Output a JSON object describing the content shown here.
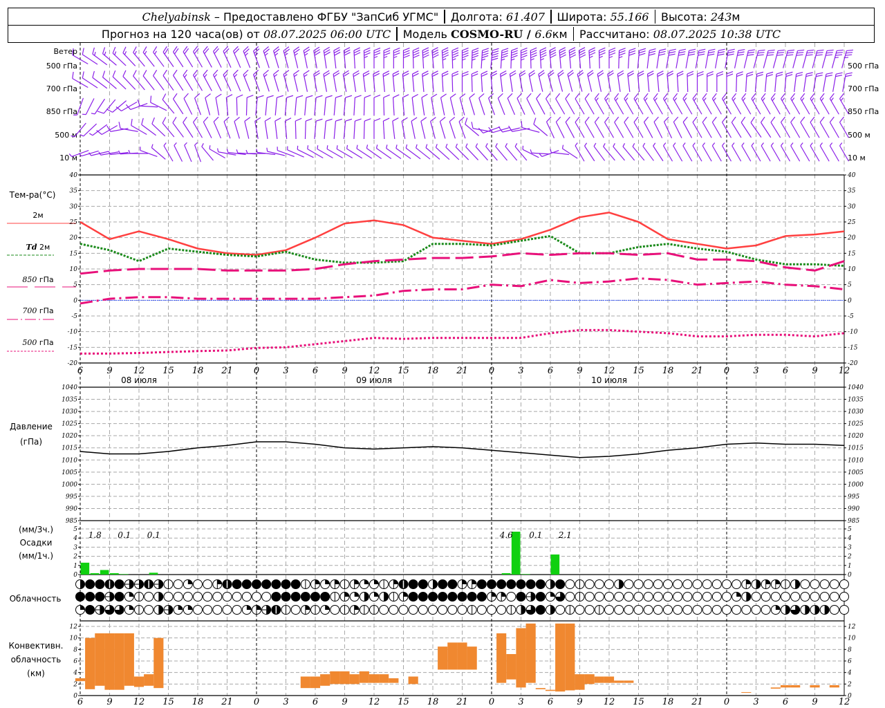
{
  "header": {
    "city": "Chelyabinsk",
    "provider": " – Предоставлено ФГБУ \"ЗапСиб УГМС\"",
    "lon_label": "Долгота: ",
    "lon": "61.407",
    "lat_label": "Широта: ",
    "lat": "55.166",
    "alt_label": "Высота: ",
    "alt": "243",
    "alt_unit": "м",
    "forecast_label": "Прогноз на 120 часа(ов) от ",
    "forecast_time": "08.07.2025 06:00 UTC",
    "model_label": "Модель ",
    "model": "COSMO-RU / ",
    "model_res": "6.6",
    "model_res_unit": "км",
    "calc_label": "Рассчитано: ",
    "calc_time": "08.07.2025 10:38 UTC"
  },
  "labels": {
    "wind": "Ветер",
    "wind_levels": [
      "500 гПа",
      "700 гПа",
      "850 гПа",
      "500 м",
      "10 м"
    ],
    "temp": "Тем-ра(°C)",
    "t2m": "2м",
    "td_a": "Td",
    "td_b": "2м",
    "t850_a": "850",
    "t850_b": "гПа",
    "t700_a": "700",
    "t700_b": "гПа",
    "t500_a": "500",
    "t500_b": "гПа",
    "pressure_a": "Давление",
    "pressure_b": "(гПа)",
    "precip_a": "(мм/3ч.)",
    "precip_b": "Осадки",
    "precip_c": "(мм/1ч.)",
    "cloud": "Облачность",
    "conv_a": "Конвективн.",
    "conv_b": "облачность",
    "conv_c": "(км)"
  },
  "colors": {
    "t2m": "#ff4040",
    "td": "#1a8a1a",
    "upper": "#e8107a",
    "wind": "#8a1ee8",
    "zero": "#3050ff",
    "precip": "#10d010",
    "conv": "#f08830",
    "grid": "#a8a8a8"
  },
  "chart_data": {
    "type": "meteogram",
    "x_hours_from_start": [
      0,
      3,
      6,
      9,
      12,
      15,
      18,
      21,
      24,
      27,
      30,
      33,
      36,
      39,
      42,
      45,
      48,
      51,
      54,
      57,
      60,
      63,
      66,
      69,
      72,
      75,
      78
    ],
    "x_tick_labels": [
      "6",
      "9",
      "12",
      "15",
      "18",
      "21",
      "0",
      "3",
      "6",
      "9",
      "12",
      "15",
      "18",
      "21",
      "0",
      "3",
      "6",
      "9",
      "12",
      "15",
      "18",
      "21",
      "0",
      "3",
      "6",
      "9",
      "12"
    ],
    "day_labels": [
      {
        "label": "08 июля",
        "hour": 6
      },
      {
        "label": "09 июля",
        "hour": 30
      },
      {
        "label": "10 июля",
        "hour": 54
      }
    ],
    "temperature": {
      "ylim": [
        -20,
        40
      ],
      "ticks": [
        "40",
        "35",
        "30",
        "25",
        "20",
        "15",
        "10",
        "5",
        "0",
        "-5",
        "-10",
        "-15",
        "-20"
      ],
      "series": [
        {
          "name": "T 2м",
          "style": "solid",
          "values": [
            25,
            19.5,
            22,
            19.5,
            16.5,
            15,
            14.5,
            16,
            20,
            24.5,
            25.5,
            24,
            20,
            19,
            18,
            19.5,
            22.5,
            26.5,
            28,
            25,
            19.5,
            18,
            16.5,
            17.5,
            20.5,
            21,
            22
          ]
        },
        {
          "name": "Td 2м",
          "style": "dotted-green",
          "values": [
            18,
            16,
            12.5,
            16.5,
            15.5,
            14.5,
            14,
            15.5,
            13,
            12,
            12,
            12.5,
            18,
            18,
            17.5,
            19,
            20.5,
            15,
            15,
            17,
            18,
            16.5,
            15.5,
            13,
            11.5,
            11.5,
            11
          ]
        },
        {
          "name": "T 850 гПа",
          "style": "long-dash",
          "values": [
            8.5,
            9.5,
            10,
            10,
            10,
            9.5,
            9.5,
            9.5,
            10,
            11.5,
            12.5,
            13,
            13.5,
            13.5,
            14,
            15,
            14.5,
            15,
            15,
            14.5,
            15,
            13,
            13,
            12.5,
            10.5,
            9.5,
            12.5
          ]
        },
        {
          "name": "T 700 гПа",
          "style": "dash-dot",
          "values": [
            -1,
            0.5,
            1,
            1,
            0.5,
            0.5,
            0.5,
            0.5,
            0.5,
            1,
            1.5,
            3,
            3.5,
            3.5,
            5,
            4.5,
            6.5,
            5.5,
            6,
            7,
            6.5,
            5,
            5.5,
            6,
            5,
            4.5,
            3.5
          ]
        },
        {
          "name": "T 500 гПа",
          "style": "dotted",
          "values": [
            -17,
            -17,
            -16.8,
            -16.5,
            -16.2,
            -16,
            -15.2,
            -15,
            -14,
            -13,
            -12,
            -12.3,
            -12,
            -12,
            -12,
            -12,
            -10.5,
            -9.5,
            -9.5,
            -10,
            -10.5,
            -11.5,
            -11.5,
            -11,
            -11,
            -11.5,
            -10.5
          ]
        }
      ]
    },
    "pressure": {
      "ylim": [
        985,
        1040
      ],
      "ticks": [
        "1040",
        "1035",
        "1030",
        "1025",
        "1020",
        "1015",
        "1010",
        "1005",
        "1000",
        "995",
        "990",
        "985"
      ],
      "values": [
        1013.5,
        1012.5,
        1012.5,
        1013.5,
        1015,
        1016,
        1017.5,
        1017.5,
        1016.5,
        1015,
        1014.5,
        1015,
        1015.5,
        1015,
        1014,
        1013,
        1012,
        1011,
        1011.5,
        1012.5,
        1014,
        1015,
        1016.5,
        1017,
        1016.5,
        1016.5,
        1016
      ]
    },
    "precipitation": {
      "ylim": [
        0,
        5
      ],
      "ticks": [
        "5",
        "4",
        "3",
        "2",
        "1",
        "0"
      ],
      "hourly_mm": [
        [
          0,
          1.3
        ],
        [
          1,
          0.15
        ],
        [
          2,
          0.5
        ],
        [
          3,
          0.15
        ],
        [
          4,
          0.05
        ],
        [
          7,
          0.2
        ],
        [
          43,
          0.15
        ],
        [
          44,
          4.7
        ],
        [
          45,
          0.05
        ],
        [
          48,
          2.2
        ]
      ],
      "three_hour_totals": [
        {
          "bin": 0,
          "label": "1.8"
        },
        {
          "bin": 1,
          "label": "0.1"
        },
        {
          "bin": 2,
          "label": "0.1"
        },
        {
          "bin": 14,
          "label": "4.6"
        },
        {
          "bin": 15,
          "label": "0.1"
        },
        {
          "bin": 16,
          "label": "2.1"
        }
      ]
    },
    "cloud_cover_octas": [
      [
        4,
        8,
        8,
        7,
        8,
        5,
        5,
        7,
        5,
        1,
        0,
        2,
        0,
        0,
        3,
        7,
        8,
        8,
        8,
        8,
        8,
        8,
        8,
        1,
        3,
        2,
        3,
        1,
        3,
        2,
        2,
        1,
        3,
        7,
        8,
        8,
        4,
        8,
        8,
        3,
        3,
        8,
        8,
        8,
        8,
        8,
        8,
        8,
        4,
        8,
        0,
        1,
        0,
        0,
        0,
        4,
        0,
        0,
        0,
        0,
        0,
        0,
        0,
        0,
        0,
        0,
        0,
        0,
        3,
        4,
        3,
        3,
        1,
        4,
        0,
        0,
        0,
        0,
        0
      ],
      [
        8,
        8,
        8,
        5,
        8,
        2,
        1,
        0,
        4,
        0,
        0,
        0,
        0,
        0,
        0,
        0,
        0,
        0,
        0,
        0,
        8,
        8,
        8,
        8,
        8,
        8,
        1,
        3,
        2,
        4,
        2,
        4,
        1,
        3,
        8,
        8,
        8,
        8,
        8,
        8,
        8,
        8,
        3,
        3,
        0,
        8,
        5,
        8,
        2,
        6,
        0,
        1,
        0,
        0,
        0,
        0,
        0,
        0,
        0,
        0,
        0,
        0,
        0,
        0,
        0,
        0,
        0,
        2,
        4,
        0,
        0,
        0,
        0,
        0,
        0,
        0,
        0,
        0,
        0
      ],
      [
        2,
        8,
        5,
        6,
        6,
        2,
        1,
        0,
        4,
        5,
        2,
        2,
        0,
        0,
        0,
        0,
        0,
        2,
        3,
        5,
        7,
        1,
        0,
        3,
        1,
        2,
        0,
        1,
        3,
        1,
        1,
        0,
        0,
        0,
        0,
        0,
        0,
        0,
        0,
        0,
        1,
        0,
        0,
        0,
        1,
        4,
        6,
        8,
        4,
        0,
        1,
        0,
        0,
        1,
        0,
        0,
        0,
        0,
        0,
        0,
        0,
        0,
        0,
        0,
        0,
        0,
        0,
        0,
        0,
        0,
        0,
        2,
        4,
        6,
        4,
        4,
        4,
        0,
        0
      ]
    ],
    "convective_cloud_km": {
      "ylim": [
        0,
        13
      ],
      "ticks": [
        "12",
        "10",
        "8",
        "6",
        "4",
        "2",
        "0"
      ],
      "bars_hour_base_top": [
        [
          0,
          2.5,
          3
        ],
        [
          1,
          1.1,
          10
        ],
        [
          2,
          1.7,
          10.8
        ],
        [
          3,
          1.0,
          10.8
        ],
        [
          4,
          1.0,
          10.8
        ],
        [
          5,
          1.7,
          10.8
        ],
        [
          6,
          1.5,
          3.3
        ],
        [
          7,
          1.7,
          3.7
        ],
        [
          8,
          1.3,
          10
        ],
        [
          23,
          1.3,
          3.3
        ],
        [
          24,
          1.3,
          3.3
        ],
        [
          25,
          1.7,
          3.7
        ],
        [
          26,
          2,
          4.2
        ],
        [
          27,
          2,
          4.2
        ],
        [
          28,
          2,
          3.7
        ],
        [
          29,
          2.2,
          4.2
        ],
        [
          30,
          2.2,
          3.7
        ],
        [
          31,
          2.2,
          3.7
        ],
        [
          32,
          2.2,
          3
        ],
        [
          34,
          2,
          3.3
        ],
        [
          37,
          4.5,
          8.5
        ],
        [
          38,
          4.5,
          9.2
        ],
        [
          39,
          4.5,
          9.2
        ],
        [
          40,
          4.5,
          8.5
        ],
        [
          43,
          2.2,
          10.8
        ],
        [
          44,
          2.8,
          7.2
        ],
        [
          45,
          1.4,
          11.7
        ],
        [
          46,
          2.2,
          12.5
        ],
        [
          47,
          1.1,
          1.3
        ],
        [
          48,
          0.8,
          1.0
        ],
        [
          49,
          0.7,
          12.5
        ],
        [
          50,
          0.9,
          12.5
        ],
        [
          51,
          1.0,
          3.7
        ],
        [
          52,
          2,
          3.7
        ],
        [
          53,
          2.2,
          3.3
        ],
        [
          54,
          2.2,
          3.3
        ],
        [
          55,
          2.2,
          2.6
        ],
        [
          56,
          2.2,
          2.6
        ],
        [
          68,
          0.5,
          0.6
        ],
        [
          71,
          1.2,
          1.4
        ],
        [
          72,
          1.4,
          1.8
        ],
        [
          73,
          1.4,
          1.8
        ],
        [
          75,
          1.4,
          1.8
        ],
        [
          77,
          1.4,
          1.8
        ]
      ]
    },
    "wind": [
      {
        "level": "500 гПа",
        "dir": [
          300,
          310,
          320,
          325,
          330,
          335,
          340,
          345,
          350,
          355,
          0,
          0,
          355,
          0,
          5,
          0,
          355,
          355,
          0,
          5,
          10,
          10,
          10,
          15,
          15,
          15,
          15
        ],
        "speed": [
          7,
          8,
          9,
          10,
          11,
          12,
          13,
          14,
          15,
          17,
          18,
          20,
          22,
          24,
          25,
          24,
          22,
          20,
          18,
          17,
          16,
          15,
          15,
          15,
          16,
          17,
          18
        ]
      },
      {
        "level": "700 гПа",
        "dir": [
          300,
          310,
          320,
          325,
          330,
          335,
          340,
          345,
          350,
          350,
          355,
          355,
          355,
          0,
          355,
          350,
          345,
          345,
          350,
          355,
          355,
          0,
          0,
          5,
          5,
          10,
          10
        ],
        "speed": [
          6,
          6,
          7,
          7,
          8,
          8,
          9,
          9,
          10,
          10,
          10,
          10,
          11,
          11,
          11,
          10,
          10,
          10,
          10,
          10,
          11,
          11,
          11,
          11,
          12,
          12,
          12
        ]
      },
      {
        "level": "850 гПа",
        "dir": [
          200,
          220,
          250,
          320,
          340,
          355,
          5,
          5,
          5,
          5,
          0,
          355,
          350,
          345,
          340,
          335,
          330,
          330,
          330,
          330,
          330,
          330,
          330,
          330,
          330,
          330,
          330
        ],
        "speed": [
          4,
          5,
          5,
          6,
          6,
          6,
          7,
          7,
          7,
          7,
          7,
          7,
          7,
          7,
          7,
          7,
          7,
          7,
          8,
          8,
          8,
          8,
          8,
          8,
          8,
          8,
          8
        ]
      },
      {
        "level": "500 м",
        "dir": [
          220,
          240,
          300,
          320,
          330,
          340,
          350,
          355,
          5,
          5,
          0,
          350,
          345,
          340,
          250,
          260,
          335,
          330,
          330,
          330,
          335,
          330,
          330,
          325,
          330,
          330,
          330
        ],
        "speed": [
          4,
          5,
          5,
          5,
          5,
          5,
          6,
          6,
          6,
          6,
          6,
          6,
          6,
          6,
          5,
          6,
          6,
          6,
          6,
          6,
          6,
          6,
          6,
          6,
          6,
          6,
          6
        ]
      },
      {
        "level": "10 м",
        "dir": [
          250,
          260,
          270,
          330,
          340,
          280,
          270,
          290,
          300,
          300,
          305,
          305,
          310,
          315,
          320,
          320,
          250,
          330,
          320,
          320,
          330,
          330,
          330,
          330,
          330,
          330,
          330
        ],
        "speed": [
          3,
          3,
          3,
          4,
          4,
          3,
          3,
          3,
          4,
          4,
          4,
          4,
          4,
          4,
          4,
          4,
          3,
          4,
          4,
          4,
          4,
          4,
          4,
          4,
          4,
          4,
          4
        ]
      }
    ]
  }
}
